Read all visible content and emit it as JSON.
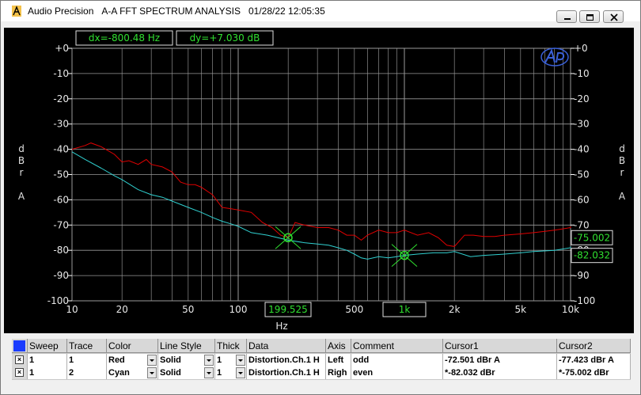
{
  "window": {
    "app_name": "Audio Precision",
    "title": "A-A FFT SPECTRUM ANALYSIS",
    "timestamp": "01/28/22 12:05:35",
    "buttons": [
      "minimize",
      "restore",
      "close"
    ]
  },
  "readouts": {
    "dx": "dx=-800.48  Hz",
    "dy": "dy=+7.030  dB",
    "cursor_x1": "199.525",
    "cursor_x2": "1k",
    "right_red": "-75.002",
    "right_cyan": "-82.032"
  },
  "axis": {
    "left_unit": [
      "d",
      "B",
      "r",
      "A"
    ],
    "right_unit": [
      "d",
      "B",
      "r",
      "A"
    ],
    "x_unit": "Hz",
    "y_ticks": [
      "+0",
      "-10",
      "-20",
      "-30",
      "-40",
      "-50",
      "-60",
      "-70",
      "-80",
      "-90",
      "-100"
    ],
    "x_ticks": [
      "10",
      "20",
      "50",
      "100",
      "200",
      "500",
      "1k",
      "2k",
      "5k",
      "10k"
    ]
  },
  "colors": {
    "red_trace": "#e00000",
    "cyan_trace": "#30d0d0",
    "grid": "#9a9a9a",
    "cursor": "#30e030",
    "readout_text": "#30e030"
  },
  "chart_data": {
    "type": "line",
    "xscale": "log",
    "xlim": [
      10,
      10000
    ],
    "ylim": [
      -100,
      0
    ],
    "xlabel": "Hz",
    "ylabel": "dBr A",
    "series": [
      {
        "name": "Red",
        "color": "#e00000",
        "x": [
          10,
          12,
          13,
          15,
          18,
          20,
          22,
          25,
          28,
          30,
          35,
          40,
          45,
          50,
          55,
          60,
          70,
          80,
          90,
          100,
          120,
          140,
          160,
          180,
          200,
          220,
          250,
          300,
          350,
          400,
          450,
          500,
          550,
          600,
          700,
          800,
          900,
          1000,
          1200,
          1400,
          1600,
          1800,
          2000,
          2300,
          2600,
          3000,
          3500,
          4000,
          5000,
          6000,
          7000,
          8000,
          9000,
          10000,
          11000
        ],
        "y": [
          -40,
          -38.5,
          -37.5,
          -39,
          -42,
          -45,
          -44.5,
          -46,
          -44,
          -46,
          -47,
          -49,
          -53,
          -54,
          -54,
          -55,
          -58,
          -63,
          -63.5,
          -64,
          -65,
          -69,
          -71,
          -74,
          -75,
          -69,
          -70,
          -71,
          -71,
          -72,
          -74,
          -74,
          -76,
          -74,
          -72,
          -73,
          -73,
          -72,
          -74,
          -73,
          -75,
          -78,
          -78.5,
          -74,
          -74,
          -74.5,
          -74.5,
          -74,
          -73.5,
          -73,
          -72.5,
          -72,
          -71.5,
          -71,
          -70.5
        ]
      },
      {
        "name": "Cyan",
        "color": "#30d0d0",
        "x": [
          10,
          12,
          15,
          18,
          20,
          25,
          30,
          35,
          40,
          50,
          60,
          70,
          80,
          90,
          100,
          120,
          150,
          200,
          250,
          300,
          350,
          400,
          450,
          500,
          550,
          600,
          700,
          800,
          900,
          1000,
          1200,
          1500,
          1800,
          2000,
          2500,
          3000,
          4000,
          5000,
          6000,
          8000,
          10000,
          11000
        ],
        "y": [
          -41,
          -44,
          -47.5,
          -50.5,
          -52,
          -56,
          -58,
          -59,
          -60.5,
          -63,
          -65,
          -67,
          -68.5,
          -69.5,
          -70.5,
          -73,
          -74,
          -76,
          -77,
          -77.5,
          -78,
          -79,
          -80,
          -81.5,
          -83,
          -83.5,
          -82.5,
          -83,
          -82.5,
          -82,
          -81.5,
          -81,
          -81,
          -80.5,
          -82.5,
          -82,
          -81.5,
          -81,
          -80.5,
          -80,
          -79,
          -78.5
        ]
      }
    ],
    "cursors": [
      {
        "x": 199.525,
        "y": -75.002
      },
      {
        "x": 1000,
        "y": -82.032
      }
    ]
  },
  "table": {
    "headers": [
      "",
      "Sweep",
      "Trace",
      "Color",
      "Line Style",
      "Thick",
      "Data",
      "Axis",
      "Comment",
      "Cursor1",
      "Cursor2"
    ],
    "rows": [
      {
        "checked": "×",
        "sweep": "1",
        "trace": "1",
        "color": "Red",
        "line_style": "Solid",
        "thick": "1",
        "data": "Distortion.Ch.1 H",
        "axis": "Left",
        "comment": "odd",
        "cursor1": "-72.501  dBr A",
        "cursor2": "-77.423  dBr A"
      },
      {
        "checked": "×",
        "sweep": "1",
        "trace": "2",
        "color": "Cyan",
        "line_style": "Solid",
        "thick": "1",
        "data": "Distortion.Ch.1 H",
        "axis": "Righ",
        "comment": "even",
        "cursor1": "*-82.032  dBr",
        "cursor2": "*-75.002  dBr"
      }
    ]
  }
}
